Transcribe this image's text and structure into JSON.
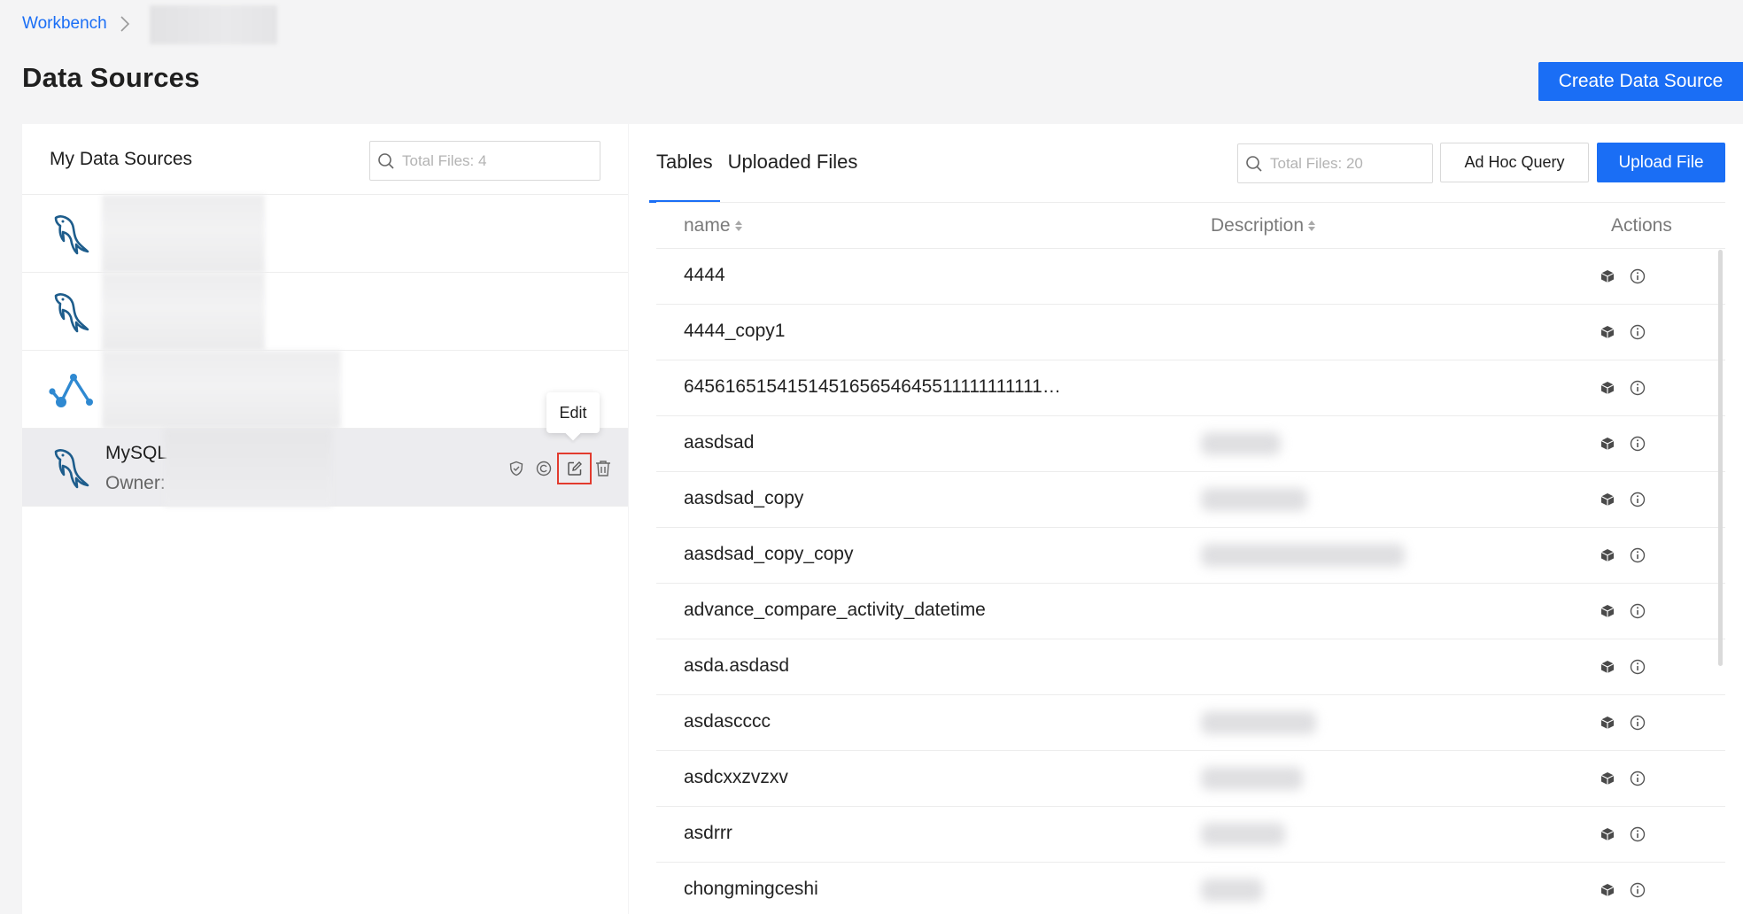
{
  "breadcrumb": {
    "root": "Workbench"
  },
  "page": {
    "title": "Data Sources",
    "create_button": "Create Data Source"
  },
  "left_panel": {
    "title": "My Data Sources",
    "search_placeholder": "Total Files: 4",
    "items": [
      {
        "icon": "mysql-dolphin-icon",
        "name": "",
        "owner": ""
      },
      {
        "icon": "mysql-dolphin-icon",
        "name": "",
        "owner": ""
      },
      {
        "icon": "graph-nodes-icon",
        "name": "",
        "owner": ""
      },
      {
        "icon": "mysql-dolphin-icon",
        "name": "MySQL",
        "owner": "Owner:",
        "selected": true,
        "actions": [
          "shield-icon",
          "refresh-icon",
          "edit-icon",
          "trash-icon"
        ],
        "tooltip": "Edit"
      }
    ]
  },
  "right_panel": {
    "tabs": [
      {
        "label": "Tables",
        "active": true
      },
      {
        "label": "Uploaded Files",
        "active": false
      }
    ],
    "search_placeholder": "Total Files: 20",
    "adhoc_button": "Ad Hoc Query",
    "upload_button": "Upload File",
    "columns": {
      "name": "name",
      "description": "Description",
      "actions": "Actions"
    },
    "rows": [
      {
        "name": "4444",
        "has_desc": false
      },
      {
        "name": "4444_copy1",
        "has_desc": false
      },
      {
        "name": "645616515415145165654645511111111111…",
        "has_desc": false
      },
      {
        "name": "aasdsad",
        "has_desc": true,
        "desc_w": 90
      },
      {
        "name": "aasdsad_copy",
        "has_desc": true,
        "desc_w": 120
      },
      {
        "name": "aasdsad_copy_copy",
        "has_desc": true,
        "desc_w": 230
      },
      {
        "name": "advance_compare_activity_datetime",
        "has_desc": false
      },
      {
        "name": "asda.asdasd",
        "has_desc": false
      },
      {
        "name": "asdascccc",
        "has_desc": true,
        "desc_w": 130
      },
      {
        "name": "asdcxxzvzxv",
        "has_desc": true,
        "desc_w": 115
      },
      {
        "name": "asdrrr",
        "has_desc": true,
        "desc_w": 95
      },
      {
        "name": "chongmingceshi",
        "has_desc": true,
        "desc_w": 70
      }
    ]
  },
  "colors": {
    "accent": "#1a6ef5",
    "highlight": "#e23b2e",
    "mysql_blue": "#1e5d8c",
    "graph_blue": "#2f89d1"
  }
}
